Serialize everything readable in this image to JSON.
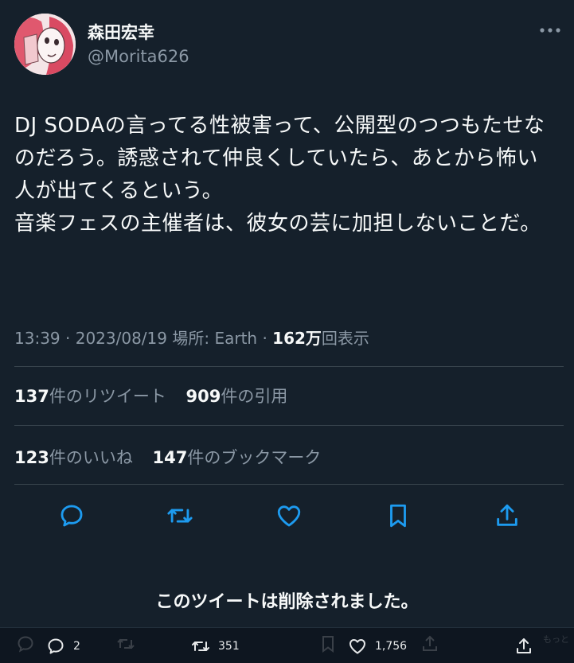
{
  "author": {
    "display_name": "森田宏幸",
    "handle": "@Morita626",
    "more_icon": "more-dots-icon"
  },
  "tweet": {
    "text": "DJ SODAの言ってる性被害って、公開型のつつもたせなのだろう。誘惑されて仲良くしていたら、あとから怖い人が出てくるという。\n音楽フェスの主催者は、彼女の芸に加担しないことだ。"
  },
  "meta": {
    "time": "13:39",
    "sep1": " · ",
    "date": "2023/08/19",
    "sep2": " ",
    "location": "場所: Earth",
    "sep3": " · ",
    "views_num": "162万",
    "views_label": "回表示"
  },
  "stats": {
    "retweets_num": "137",
    "retweets_label": "件のリツイート",
    "quotes_num": "909",
    "quotes_label": "件の引用",
    "likes_num": "123",
    "likes_label": "件のいいね",
    "bookmarks_num": "147",
    "bookmarks_label": "件のブックマーク"
  },
  "actions": [
    "reply-icon",
    "retweet-icon",
    "like-icon",
    "bookmark-icon",
    "share-icon"
  ],
  "deleted_notice": "このツイートは削除されました。",
  "bottom_bar": {
    "reply_count": "2",
    "retweet_count": "351",
    "like_count": "1,756",
    "faint_text": "もっと"
  },
  "colors": {
    "background": "#15202b",
    "text": "#f7f9f9",
    "secondary": "#8b98a5",
    "divider": "#38444d",
    "icon": "#1d9bf0"
  }
}
